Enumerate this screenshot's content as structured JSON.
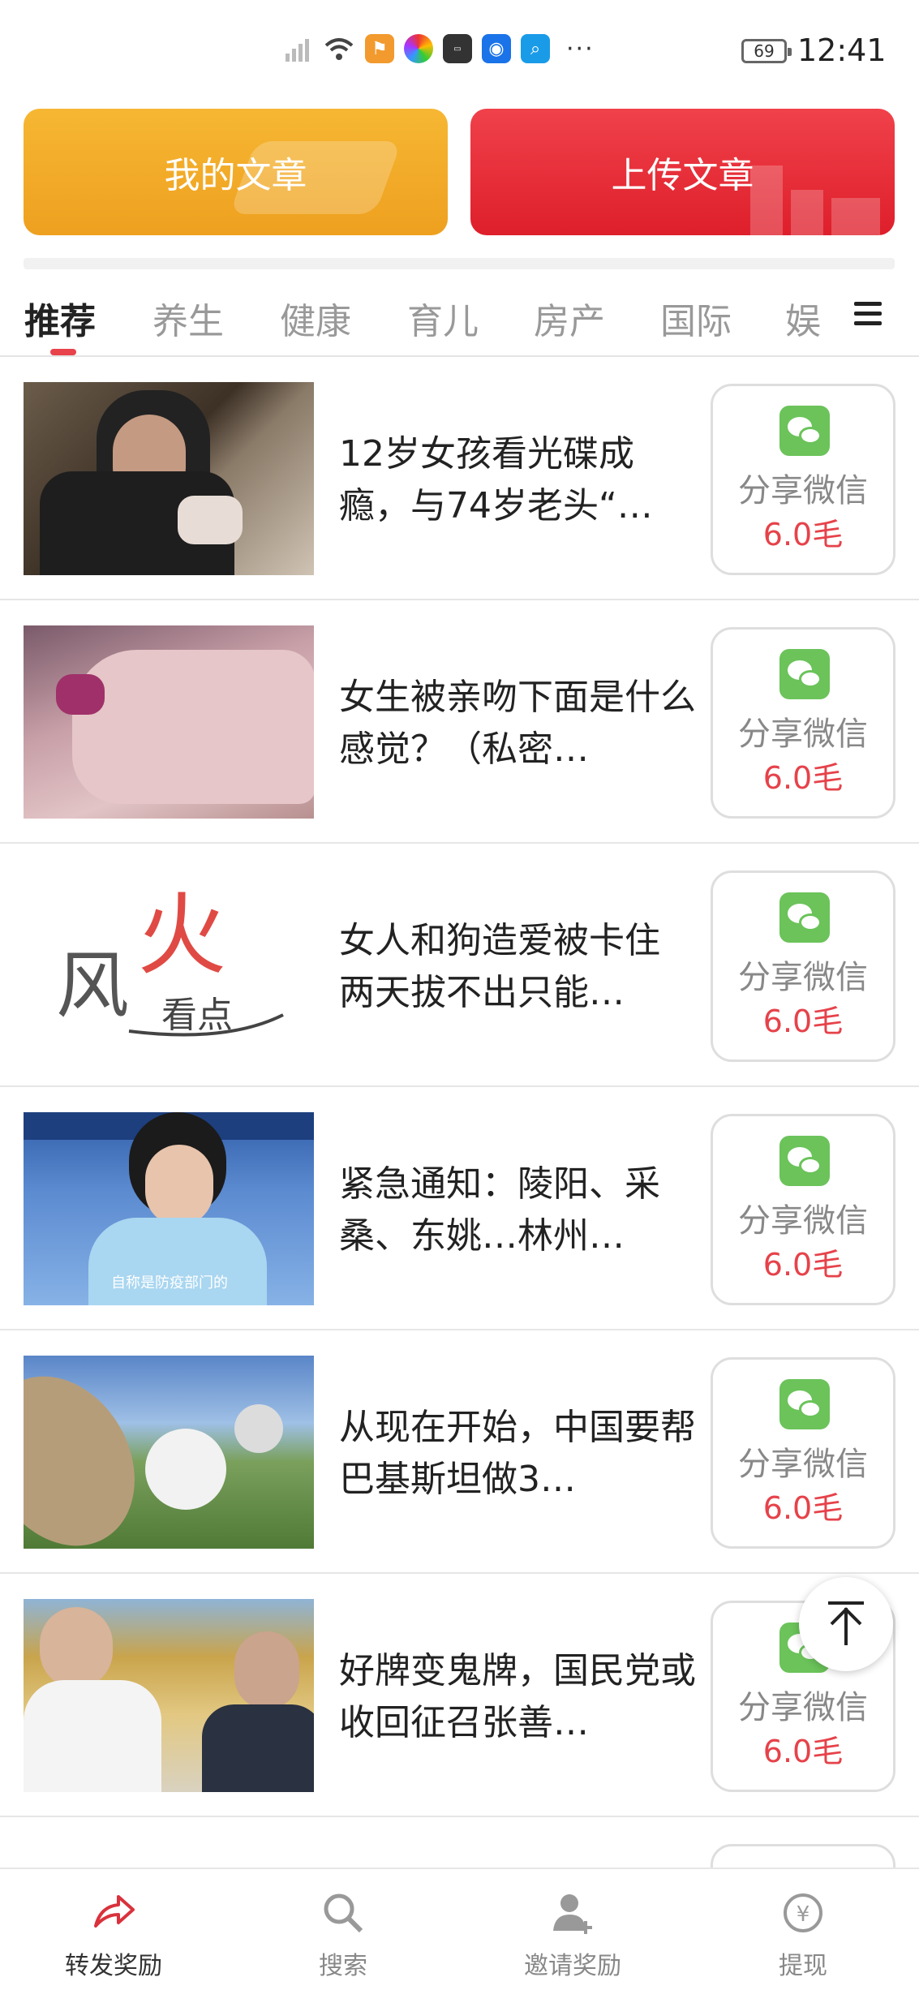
{
  "statusbar": {
    "time": "12:41",
    "battery": "69",
    "more": "···"
  },
  "buttons": {
    "my_articles": "我的文章",
    "upload_article": "上传文章"
  },
  "tabs": [
    "推荐",
    "养生",
    "健康",
    "育儿",
    "房产",
    "国际",
    "娱"
  ],
  "share": {
    "label": "分享微信",
    "price": "6.0毛"
  },
  "articles": [
    {
      "title": "12岁女孩看光碟成瘾，与74岁老头“…"
    },
    {
      "title": "女生被亲吻下面是什么感觉？（私密…"
    },
    {
      "title": "女人和狗造爱被卡住 两天拔不出只能…",
      "logo_text": "风火看点"
    },
    {
      "title": "紧急通知：陵阳、采桑、东姚…林州…",
      "caption": "自称是防疫部门的"
    },
    {
      "title": "从现在开始，中国要帮巴基斯坦做3…"
    },
    {
      "title": "好牌变鬼牌，国民党或收回征召张善…"
    }
  ],
  "bottom_nav": [
    "转发奖励",
    "搜索",
    "邀请奖励",
    "提现"
  ],
  "colors": {
    "accent_red": "#e6424a",
    "orange": "#f2a928",
    "wechat_green": "#6bc35a"
  }
}
